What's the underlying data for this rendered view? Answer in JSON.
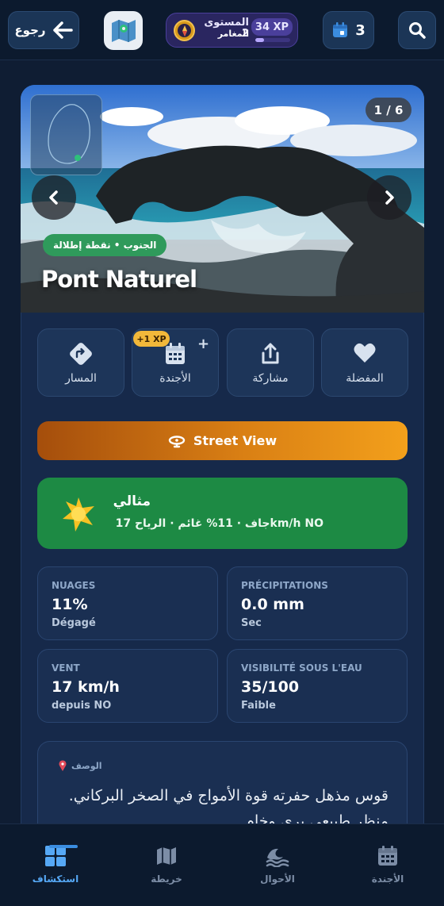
{
  "topbar": {
    "back_label": "رجوع",
    "level_label": "المستوى 2",
    "level_title": "المغامر",
    "xp_label": "34 XP",
    "xp_progress": 0.25,
    "agenda_count": "3"
  },
  "hero": {
    "counter": "1 / 6",
    "tag": "الجنوب • نقطة إطلالة",
    "place_name": "Pont Naturel"
  },
  "actions": {
    "route": "المسار",
    "agenda": "الأجندة",
    "share": "مشاركة",
    "favorite": "المفضلة",
    "xp_chip": "+1 XP",
    "plus": "+"
  },
  "street_view_label": "Street View",
  "weather": {
    "title": "مثالي",
    "summary": "جاف · 11% غائم · الرياح 17km/h NO"
  },
  "stats": [
    {
      "key": "NUAGES",
      "value": "11%",
      "sub": "Dégagé"
    },
    {
      "key": "PRÉCIPITATIONS",
      "value": "0.0 mm",
      "sub": "Sec"
    },
    {
      "key": "VENT",
      "value": "17 km/h",
      "sub": "depuis NO"
    },
    {
      "key": "VISIBILITÉ SOUS L'EAU",
      "value": "35/100",
      "sub": "Faible"
    }
  ],
  "description": {
    "label": "الوصف",
    "text": "قوس مذهل حفرته قوة الأمواج في الصخر البركاني. منظر طبيعي بري وخام."
  },
  "bottom_nav": {
    "explore": "استكشاف",
    "map": "خريطة",
    "conditions": "الأحوال",
    "agenda": "الأجندة"
  },
  "colors": {
    "accent": "#56a8f5",
    "weather_green": "#1d8a44",
    "street_orange": "#f3a01b",
    "tag_green": "#2f9a5b"
  }
}
